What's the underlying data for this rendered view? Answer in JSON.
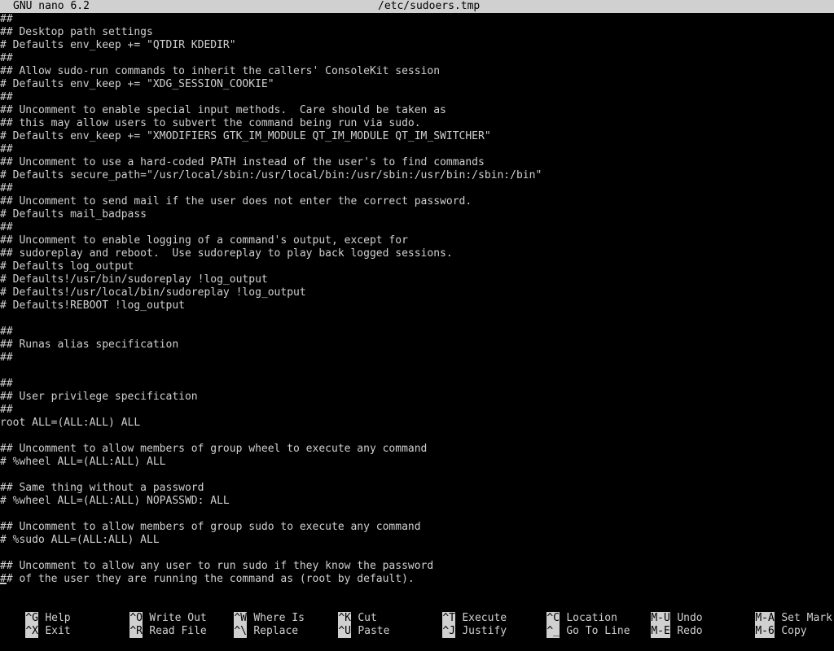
{
  "titlebar": {
    "app_name": "GNU nano 6.2",
    "file_name": "/etc/sudoers.tmp"
  },
  "editor": {
    "lines": [
      "##",
      "## Desktop path settings",
      "# Defaults env_keep += \"QTDIR KDEDIR\"",
      "##",
      "## Allow sudo-run commands to inherit the callers' ConsoleKit session",
      "# Defaults env_keep += \"XDG_SESSION_COOKIE\"",
      "##",
      "## Uncomment to enable special input methods.  Care should be taken as",
      "## this may allow users to subvert the command being run via sudo.",
      "# Defaults env_keep += \"XMODIFIERS GTK_IM_MODULE QT_IM_MODULE QT_IM_SWITCHER\"",
      "##",
      "## Uncomment to use a hard-coded PATH instead of the user's to find commands",
      "# Defaults secure_path=\"/usr/local/sbin:/usr/local/bin:/usr/sbin:/usr/bin:/sbin:/bin\"",
      "##",
      "## Uncomment to send mail if the user does not enter the correct password.",
      "# Defaults mail_badpass",
      "##",
      "## Uncomment to enable logging of a command's output, except for",
      "## sudoreplay and reboot.  Use sudoreplay to play back logged sessions.",
      "# Defaults log_output",
      "# Defaults!/usr/bin/sudoreplay !log_output",
      "# Defaults!/usr/local/bin/sudoreplay !log_output",
      "# Defaults!REBOOT !log_output",
      "",
      "##",
      "## Runas alias specification",
      "##",
      "",
      "##",
      "## User privilege specification",
      "##",
      "root ALL=(ALL:ALL) ALL",
      "",
      "## Uncomment to allow members of group wheel to execute any command",
      "# %wheel ALL=(ALL:ALL) ALL",
      "",
      "## Same thing without a password",
      "# %wheel ALL=(ALL:ALL) NOPASSWD: ALL",
      "",
      "## Uncomment to allow members of group sudo to execute any command",
      "# %sudo ALL=(ALL:ALL) ALL",
      "",
      "## Uncomment to allow any user to run sudo if they know the password",
      "## of the user they are running the command as (root by default)."
    ]
  },
  "shortcuts": [
    {
      "key": "^G",
      "label": "Help"
    },
    {
      "key": "^X",
      "label": "Exit"
    },
    {
      "key": "^O",
      "label": "Write Out"
    },
    {
      "key": "^R",
      "label": "Read File"
    },
    {
      "key": "^W",
      "label": "Where Is"
    },
    {
      "key": "^\\",
      "label": "Replace"
    },
    {
      "key": "^K",
      "label": "Cut"
    },
    {
      "key": "^U",
      "label": "Paste"
    },
    {
      "key": "^T",
      "label": "Execute"
    },
    {
      "key": "^J",
      "label": "Justify"
    },
    {
      "key": "^C",
      "label": "Location"
    },
    {
      "key": "^_",
      "label": "Go To Line"
    },
    {
      "key": "M-U",
      "label": "Undo"
    },
    {
      "key": "M-E",
      "label": "Redo"
    },
    {
      "key": "M-A",
      "label": "Set Mark"
    },
    {
      "key": "M-6",
      "label": "Copy"
    }
  ],
  "colors": {
    "foreground": "#d0d0d0",
    "background": "#000000"
  }
}
